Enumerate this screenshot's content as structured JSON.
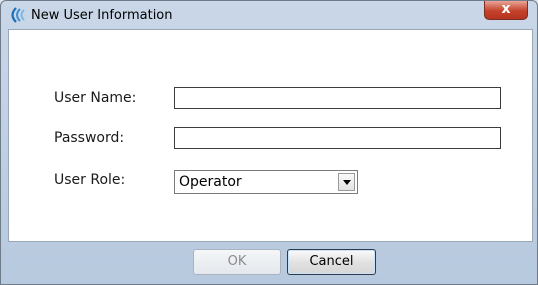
{
  "window": {
    "title": "New User Information",
    "close_label": "x"
  },
  "form": {
    "username_label": "User Name:",
    "username_value": "",
    "password_label": "Password:",
    "password_value": "",
    "role_label": "User Role:",
    "role_value": "Operator"
  },
  "buttons": {
    "ok_label": "OK",
    "cancel_label": "Cancel"
  }
}
